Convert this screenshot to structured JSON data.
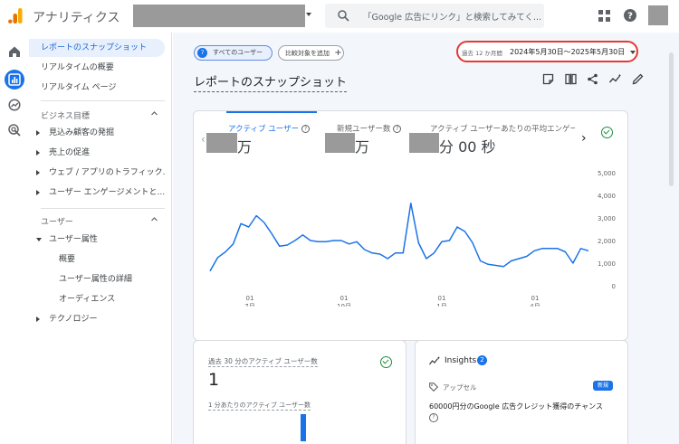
{
  "topbar": {
    "app_title": "アナリティクス",
    "search_placeholder": "「Google 広告にリンク」と検索してみてく..."
  },
  "sidebar": {
    "items": [
      {
        "label": "レポートのスナップショット",
        "active": true
      },
      {
        "label": "リアルタイムの概要"
      },
      {
        "label": "リアルタイム ページ"
      }
    ],
    "section1": {
      "label": "ビジネス目標",
      "items": [
        "見込み顧客の発掘",
        "売上の促進",
        "ウェブ / アプリのトラフィック...",
        "ユーザー エンゲージメントと..."
      ]
    },
    "section2": {
      "label": "ユーザー",
      "group": "ユーザー属性",
      "sub_items": [
        "概要",
        "ユーザー属性の詳細",
        "オーディエンス"
      ],
      "collapsed": "テクノロジー"
    }
  },
  "filters": {
    "all_users": "すべてのユーザー",
    "all_users_badge": "7",
    "add_compare": "比較対象を追加",
    "add_icon": "+"
  },
  "date_range": {
    "prefix": "過去 12 か月間",
    "text": "2024年5月30日〜2025年5月30日"
  },
  "page_title": "レポートのスナップショット",
  "metrics": {
    "tabs": [
      {
        "label": "アクティブ ユーザー",
        "unit": "万",
        "active": true
      },
      {
        "label": "新規ユーザー数",
        "unit": "万"
      },
      {
        "label": "アクティブ ユーザーあたりの平均エンゲー",
        "unit": "分 00 秒"
      }
    ]
  },
  "chart_data": {
    "type": "line",
    "y_ticks": [
      "5,000",
      "4,000",
      "3,000",
      "2,000",
      "1,000",
      "0"
    ],
    "ylim": [
      0,
      5000
    ],
    "x_ticks": [
      {
        "day": "01",
        "month": "7月"
      },
      {
        "day": "01",
        "month": "10月"
      },
      {
        "day": "01",
        "month": "1月"
      },
      {
        "day": "01",
        "month": "4月"
      }
    ],
    "series": [
      {
        "color": "#1a73e8",
        "values": [
          650,
          1250,
          1500,
          1850,
          2750,
          2600,
          3100,
          2800,
          2300,
          1750,
          1800,
          2000,
          2250,
          2000,
          1950,
          1950,
          2000,
          2000,
          1850,
          1950,
          1600,
          1450,
          1400,
          1200,
          1450,
          1450,
          3650,
          1900,
          1200,
          1450,
          1950,
          2000,
          2600,
          2400,
          1900,
          1100,
          950,
          900,
          850,
          1100,
          1200,
          1300,
          1550,
          1650,
          1650,
          1650,
          1500,
          1000,
          1650,
          1550
        ]
      }
    ]
  },
  "realtime": {
    "label": "過去 30 分のアクティブ ユーザー数",
    "value": "1",
    "sub_label": "1 分あたりのアクティブ ユーザー数"
  },
  "insights": {
    "title": "Insights",
    "count": "2",
    "tag": "アップセル",
    "new_badge": "新規",
    "text": "60000円分のGoogle 広告クレジット獲得のチャンス",
    "help": "?"
  }
}
